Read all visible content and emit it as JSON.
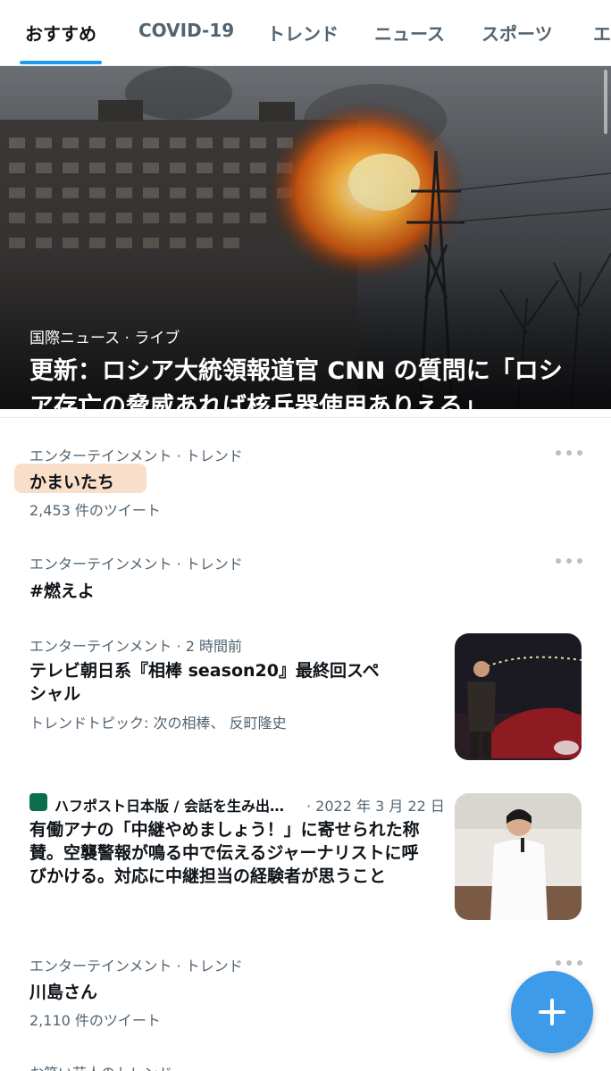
{
  "tabs": [
    "おすすめ",
    "COVID-19",
    "トレンド",
    "ニュース",
    "スポーツ",
    "エ"
  ],
  "hero": {
    "meta": "国際ニュース · ライブ",
    "title": "更新：ロシア大統領報道官 CNN の質問に「ロシア存亡の脅威あれば核兵器使用ありえる」"
  },
  "trends": [
    {
      "category": "エンターテインメント · トレンド",
      "name": "かまいたち",
      "count": "2,453 件のツイート"
    },
    {
      "category": "エンターテインメント · トレンド",
      "name": "#燃えよ"
    },
    {
      "category": "エンターテインメント · 2 時間前",
      "name": "テレビ朝日系『相棒 season20』最終回スペシャル",
      "topics": "トレンドトピック: 次の相棒、 反町隆史"
    },
    {
      "category": "エンターテインメント · トレンド",
      "name": "川島さん",
      "count": "2,110 件のツイート"
    },
    {
      "category": "お笑い芸人のトレンド"
    }
  ],
  "news": {
    "source": "ハフポスト日本版 / 会話を生み出…",
    "date": "· 2022 年 3 月 22 日",
    "body": "有働アナの「中継やめましょう！」に寄せられた称賛。空襲警報が鳴る中で伝えるジャーナリストに呼びかける。対応に中継担当の経験者が思うこと"
  },
  "colors": {
    "accent": "#1d9bf0",
    "fab": "#3e9be9",
    "highlight": "#f9dfca"
  },
  "icons": {
    "more": "more-dots-icon",
    "compose": "plus-icon"
  }
}
